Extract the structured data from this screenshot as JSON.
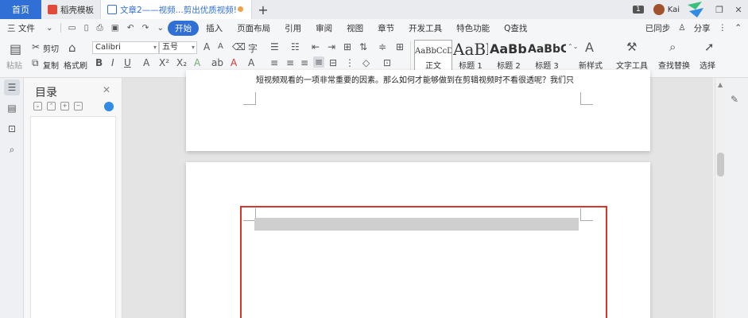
{
  "titlebar": {
    "home_tab": "首页",
    "tabs": [
      {
        "label": "稻壳模板"
      },
      {
        "label": "文章2——视频...剪出优质视频!"
      }
    ],
    "plus": "+",
    "badge": "1",
    "user": "Kai"
  },
  "menubar": {
    "file": "三 文件",
    "items": [
      "开始",
      "插入",
      "页面布局",
      "引用",
      "审阅",
      "视图",
      "章节",
      "开发工具",
      "特色功能"
    ],
    "search": "Q查找",
    "sync": "已同步",
    "share": "分享"
  },
  "ribbon": {
    "paste": "粘贴",
    "cut": "剪切",
    "copy": "复制",
    "format_painter": "格式刷",
    "font_name": "Calibri",
    "font_size": "五号",
    "styles": [
      {
        "sample": "AaBbCcDd",
        "label": "正文"
      },
      {
        "sample": "AaBl",
        "label": "标题 1"
      },
      {
        "sample": "AaBb(",
        "label": "标题 2"
      },
      {
        "sample": "AaBbC",
        "label": "标题 3"
      }
    ],
    "new_style": "新样式",
    "text_tools": "文字工具",
    "find_replace": "查找替换",
    "select": "选择"
  },
  "toc": {
    "title": "目录"
  },
  "document": {
    "page1_text": "短视频观看的一项非常重要的因素。那么如何才能够做到在剪辑视频时不看很透呢？我们只"
  },
  "colors": {
    "accent": "#2f6fd6",
    "highlight_box": "#d9352b"
  }
}
